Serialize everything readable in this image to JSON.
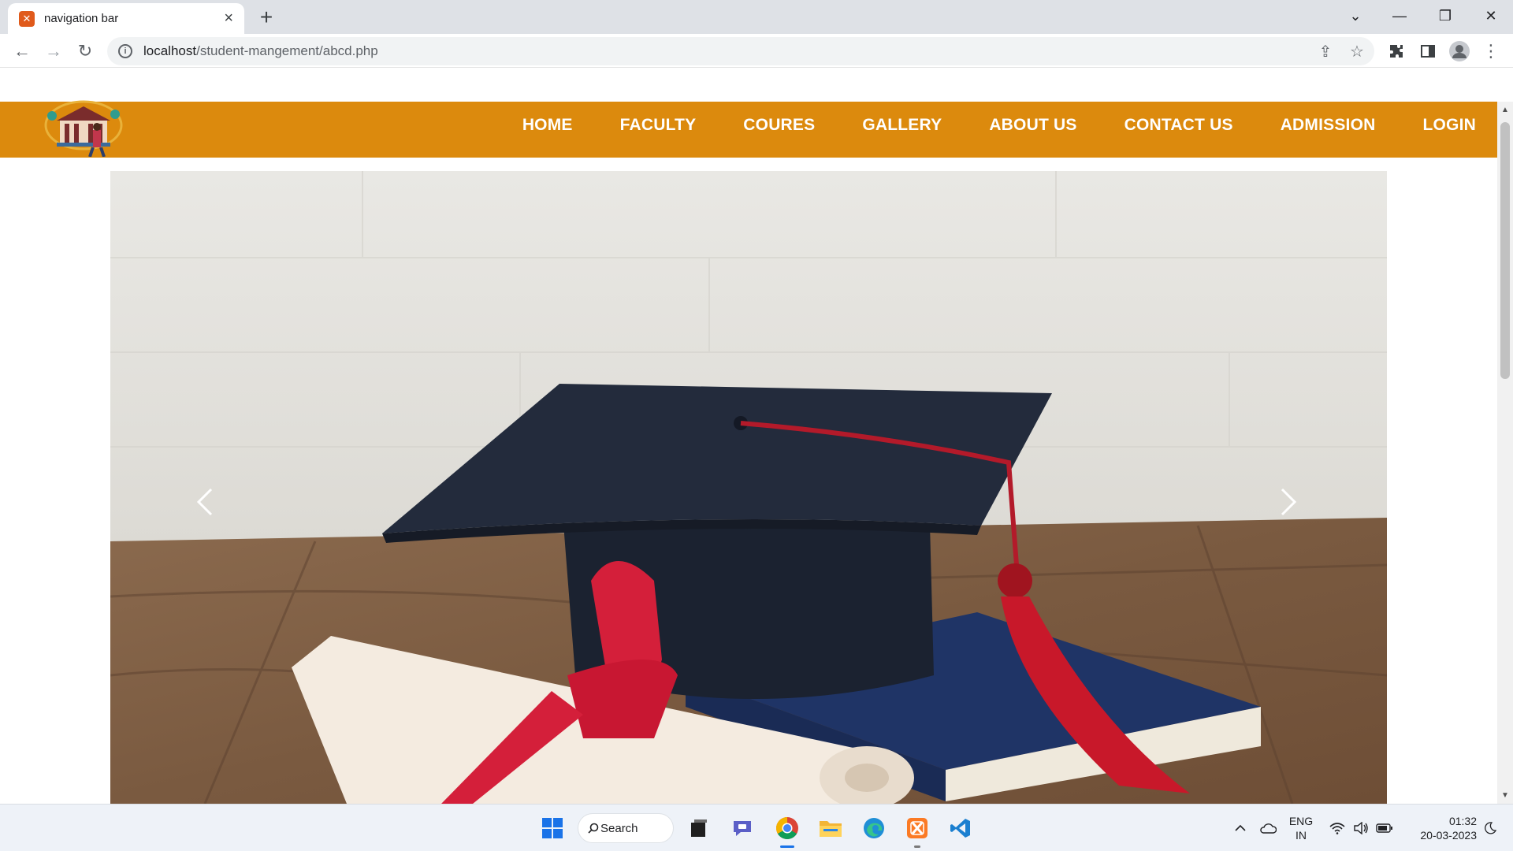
{
  "browser": {
    "tab_title": "navigation bar",
    "url_host": "localhost",
    "url_path": "/student-mangement/abcd.php"
  },
  "navbar": {
    "items": [
      "HOME",
      "FACULTY",
      "COURES",
      "GALLERY",
      "ABOUT US",
      "CONTACT US",
      "ADMISSION",
      "LOGIN"
    ],
    "background": "#dc8a0d"
  },
  "carousel": {
    "prev_icon": "chevron-left-icon",
    "next_icon": "chevron-right-icon"
  },
  "taskbar": {
    "search_label": "Search",
    "lang_line1": "ENG",
    "lang_line2": "IN",
    "time": "01:32",
    "date": "20-03-2023"
  }
}
